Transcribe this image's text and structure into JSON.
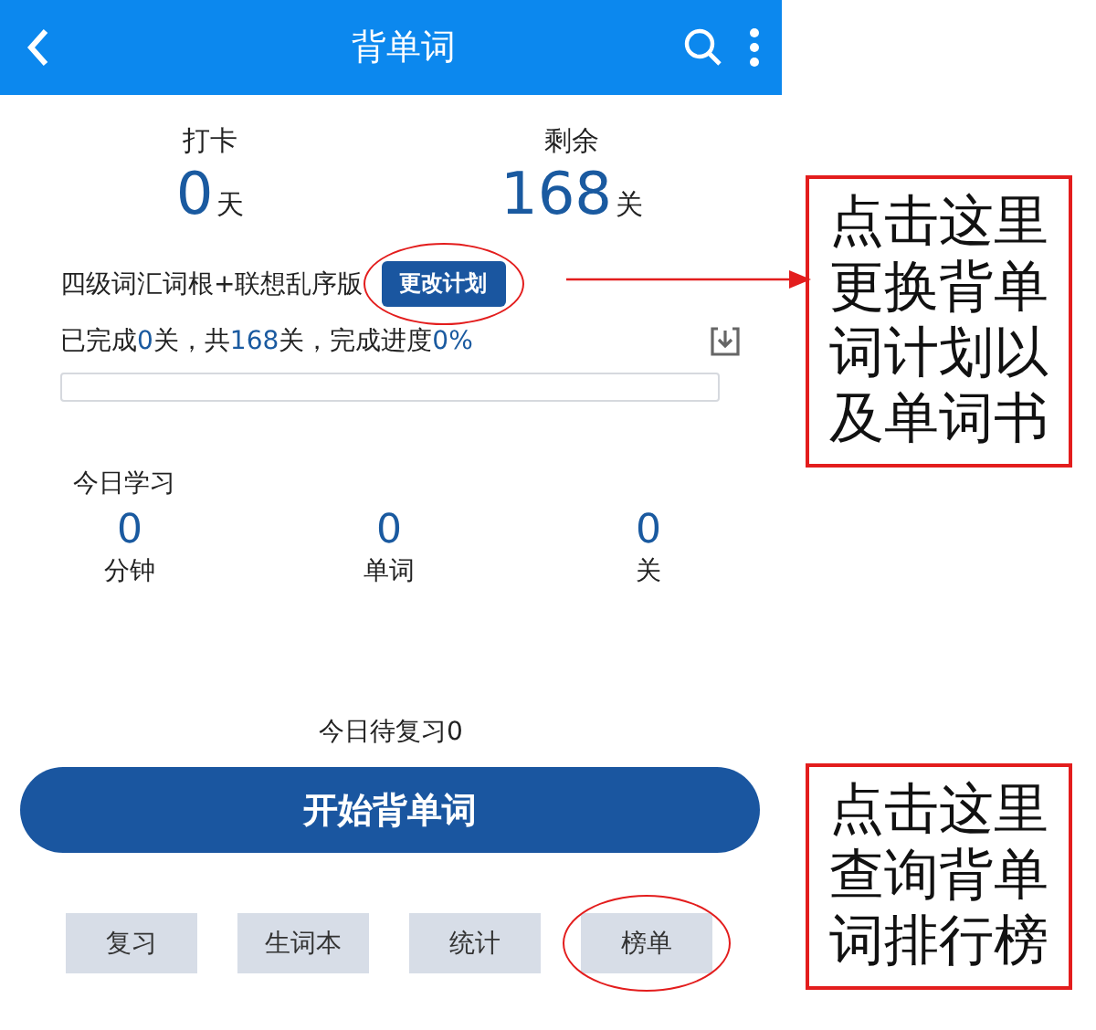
{
  "header": {
    "title": "背单词"
  },
  "summary": [
    {
      "label": "打卡",
      "value": "0",
      "unit": "天"
    },
    {
      "label": "剩余",
      "value": "168",
      "unit": "关"
    }
  ],
  "plan": {
    "name": "四级词汇词根+联想乱序版",
    "change_button": {
      "label": "更改计划",
      "circled": true
    },
    "progress_segments": [
      {
        "text": "已完成",
        "highlight": false
      },
      {
        "text": "0",
        "highlight": true
      },
      {
        "text": "关，共",
        "highlight": false
      },
      {
        "text": "168",
        "highlight": true
      },
      {
        "text": "关，完成进度",
        "highlight": false
      },
      {
        "text": "0%",
        "highlight": true
      }
    ],
    "level": 0
  },
  "today": {
    "title": "今日学习",
    "stats": [
      {
        "value": "0",
        "label": "分钟"
      },
      {
        "value": "0",
        "label": "单词"
      },
      {
        "value": "0",
        "label": "关"
      }
    ]
  },
  "review_text": "今日待复习0",
  "start_button": "开始背单词",
  "bottom_buttons": [
    {
      "label": "复习",
      "circled": false
    },
    {
      "label": "生词本",
      "circled": false
    },
    {
      "label": "统计",
      "circled": false
    },
    {
      "label": "榜单",
      "circled": true
    }
  ],
  "callouts": [
    {
      "text": "点击这里更换背单词计划以及单词书"
    },
    {
      "text": "点击这里查询背单词排行榜"
    }
  ]
}
